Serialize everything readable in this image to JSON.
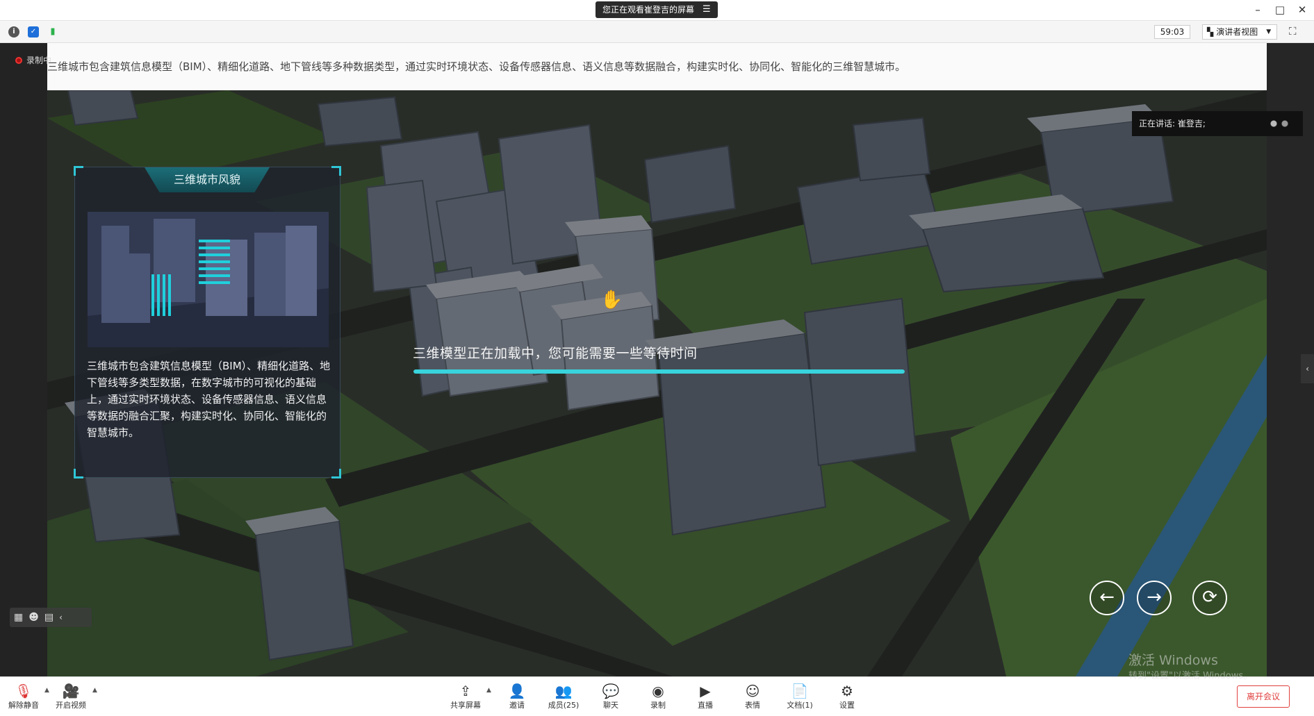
{
  "titlebar": {
    "screen_notice": "您正在观看崔登吉的屏幕",
    "menu_icon": "menu-icon",
    "minimize_icon": "minimize-icon",
    "maximize_icon": "maximize-icon",
    "close_icon": "close-icon"
  },
  "toolbar": {
    "info_icon": "info-icon",
    "security_icon": "shield-icon",
    "signal_icon": "signal-icon",
    "timer": "59:03",
    "view_label": "演讲者视图",
    "fullscreen_icon": "fullscreen-icon"
  },
  "recording": {
    "label": "录制中"
  },
  "shared_screen": {
    "caption": "三维城市包含建筑信息模型（BIM）、精细化道路、地下管线等多种数据类型，通过实时环境状态、设备传感器信息、语义信息等数据融合，构建实时化、协同化、智能化的三维智慧城市。",
    "panel_title": "三维城市风貌",
    "panel_text": "三维城市包含建筑信息模型（BIM）、精细化道路、地下管线等多类型数据，在数字城市的可视化的基础上，通过实时环境状态、设备传感器信息、语义信息等数据的融合汇聚，构建实时化、协同化、智能化的智慧城市。",
    "loading_text": "三维模型正在加载中，您可能需要一些等待时间",
    "loading_progress": 1.0,
    "nav": {
      "prev": "←",
      "next": "→",
      "reload": "⟳"
    },
    "watermark_line1": "激活 Windows",
    "watermark_line2": "转到\"设置\"以激活 Windows。"
  },
  "speaking": {
    "label": "正在讲话: 崔登吉;"
  },
  "bottombar": {
    "unmute": "解除静音",
    "start_video": "开启视频",
    "share_screen": "共享屏幕",
    "invite": "邀请",
    "members": "成员(25)",
    "chat": "聊天",
    "record": "录制",
    "live": "直播",
    "reactions": "表情",
    "docs": "文档(1)",
    "settings": "设置",
    "leave": "离开会议"
  },
  "colors": {
    "accent": "#38d3dc",
    "leave": "#e0403f",
    "record": "#e33333"
  }
}
